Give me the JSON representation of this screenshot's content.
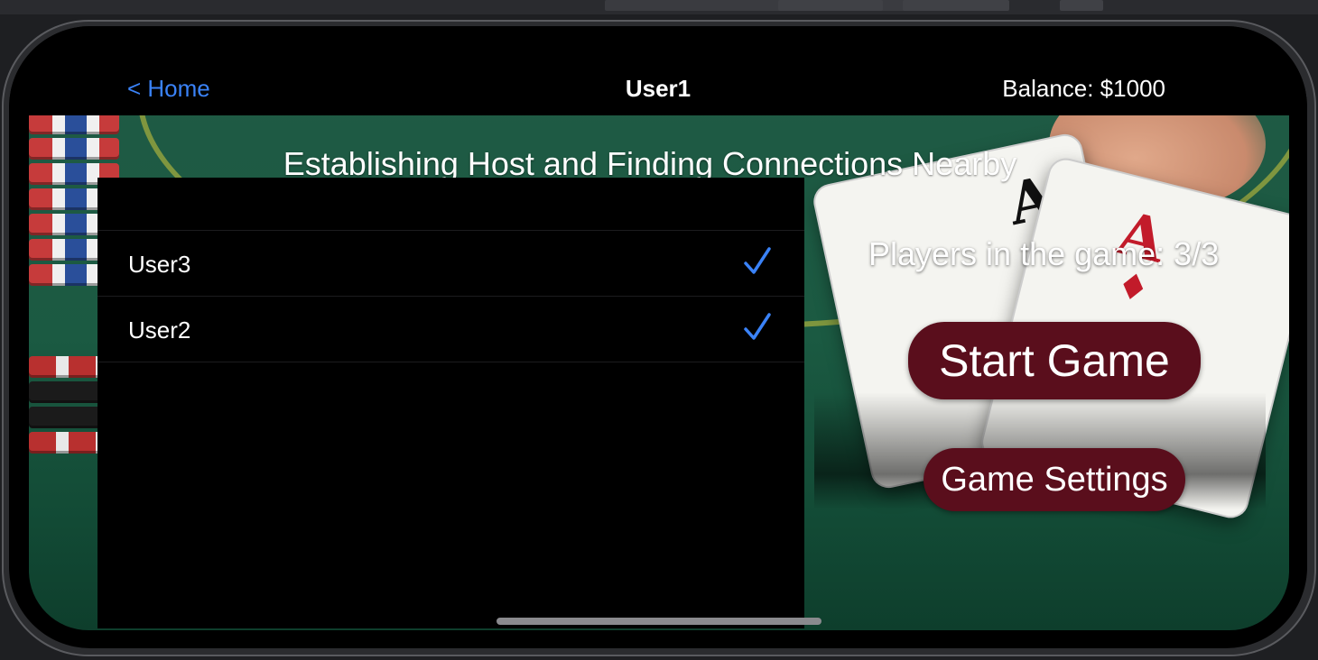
{
  "navbar": {
    "back_label": "< Home",
    "title": "User1",
    "balance": "Balance: $1000"
  },
  "headline": "Establishing Host and Finding Connections Nearby",
  "connections": [
    {
      "name": "User3",
      "checked": true
    },
    {
      "name": "User2",
      "checked": true
    }
  ],
  "players_status": "Players in the game: 3/3",
  "buttons": {
    "start": "Start Game",
    "settings": "Game Settings"
  },
  "colors": {
    "accent": "#3a82f7",
    "button_bg": "#5a0e1c",
    "felt": "#1b5a42"
  },
  "icons": {
    "check": "checkmark-icon"
  }
}
